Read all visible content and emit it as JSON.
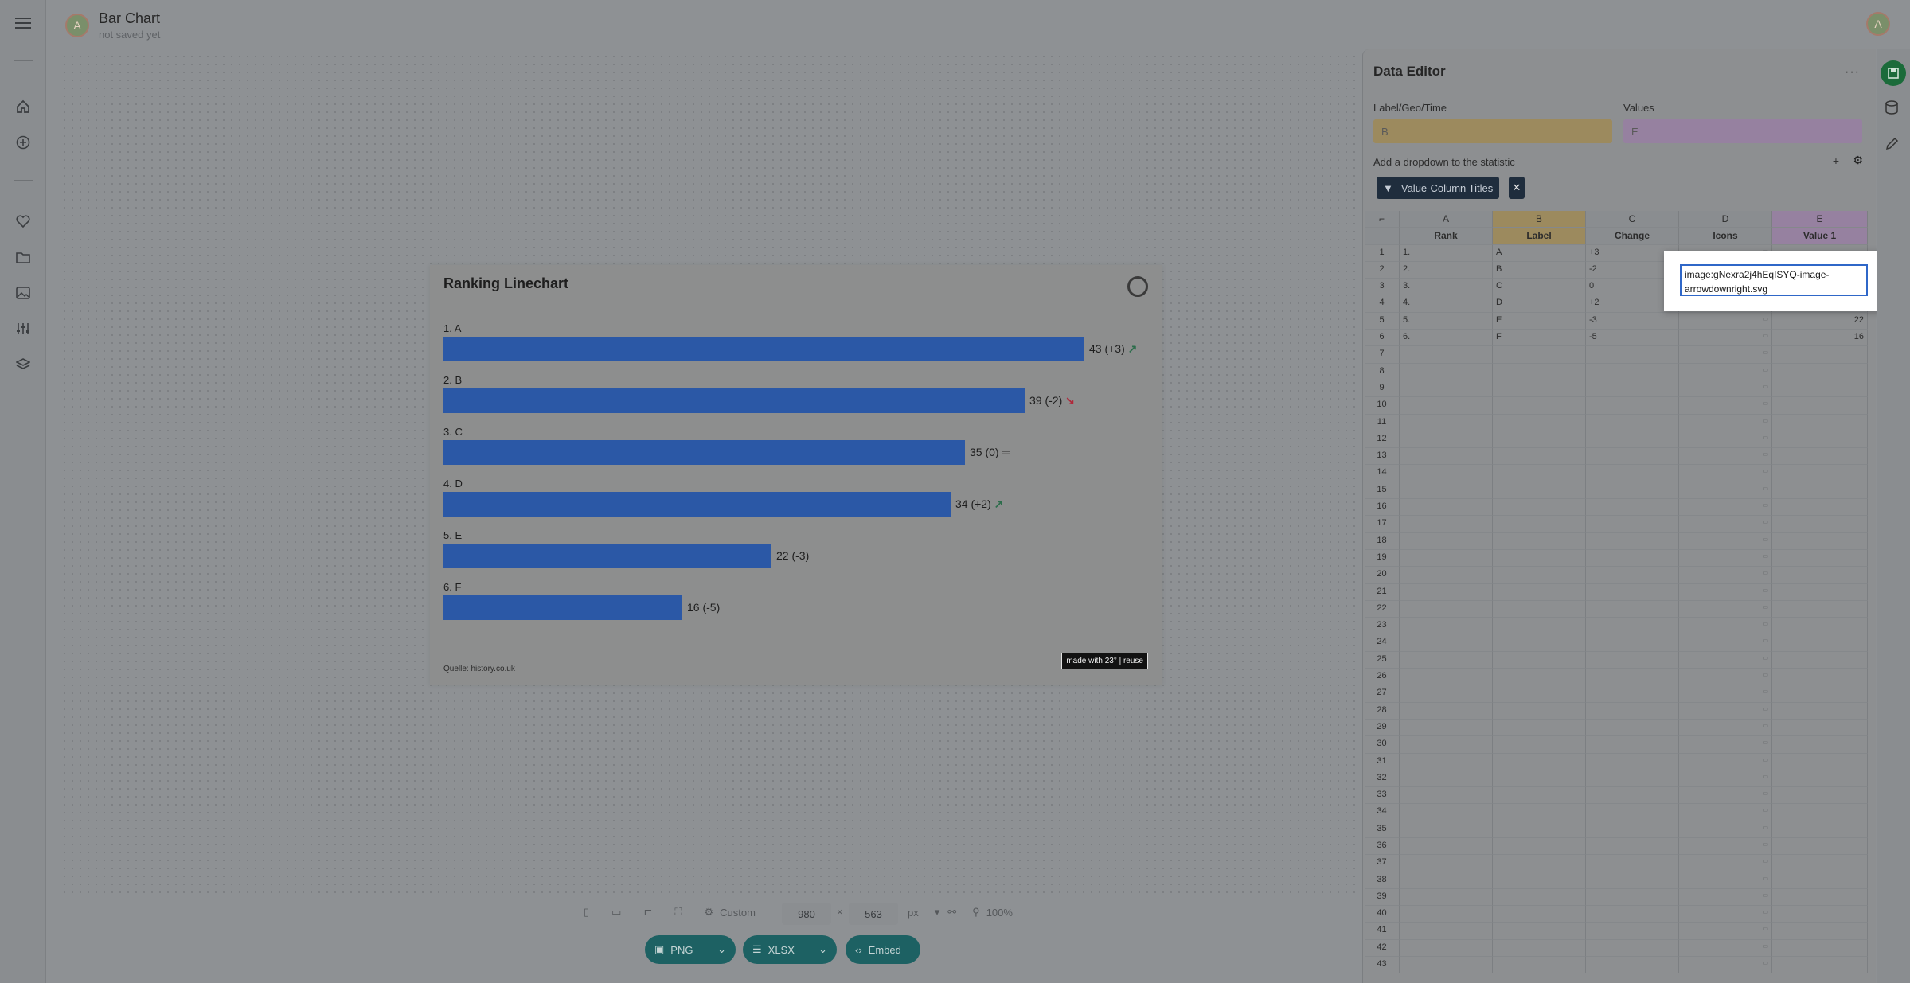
{
  "header": {
    "avatar_letter": "A",
    "title": "Bar Chart",
    "subtitle": "not saved yet",
    "user_avatar": "A"
  },
  "chart": {
    "title": "Ranking Linechart",
    "source": "Quelle: history.co.uk",
    "madewith": "made with 23° | reuse",
    "colors": {
      "bar": "#2b58a6",
      "up": "#2c6d4b",
      "down": "#b0283a"
    }
  },
  "chart_data": {
    "type": "bar",
    "title": "Ranking Linechart",
    "categories": [
      "1. A",
      "2. B",
      "3. C",
      "4. D",
      "5. E",
      "6. F"
    ],
    "values": [
      43,
      39,
      35,
      34,
      22,
      16
    ],
    "value_labels": [
      "43 (+3)",
      "39 (-2)",
      "35 (0)",
      "34 (+2)",
      "22 (-3)",
      "16 (-5)"
    ],
    "trends": [
      "up",
      "down",
      "equal",
      "up",
      "none",
      "none"
    ],
    "xlim": [
      0,
      43
    ]
  },
  "toolbar": {
    "preset": "Custom",
    "width": "980",
    "times": "×",
    "height": "563",
    "unit": "px",
    "zoom": "100%",
    "png": "PNG",
    "xlsx": "XLSX",
    "embed": "Embed"
  },
  "editor": {
    "title": "Data Editor",
    "label_field": "Label/Geo/Time",
    "label_value": "B",
    "values_field": "Values",
    "values_value": "E",
    "dropdown_label": "Add a dropdown to the statistic",
    "chip": "Value-Column Titles",
    "columns": [
      "A",
      "B",
      "C",
      "D",
      "E"
    ],
    "headers": [
      "Rank",
      "Label",
      "Change",
      "Icons",
      "Value 1"
    ],
    "rows": [
      [
        "1.",
        "A",
        "+3",
        "",
        ""
      ],
      [
        "2.",
        "B",
        "-2",
        "",
        ""
      ],
      [
        "3.",
        "C",
        "0",
        "",
        ""
      ],
      [
        "4.",
        "D",
        "+2",
        "",
        ""
      ],
      [
        "5.",
        "E",
        "-3",
        "",
        "22"
      ],
      [
        "6.",
        "F",
        "-5",
        "",
        "16"
      ]
    ],
    "popup_value": "image:gNexra2j4hEqISYQ-image-arrowdownright.svg"
  }
}
